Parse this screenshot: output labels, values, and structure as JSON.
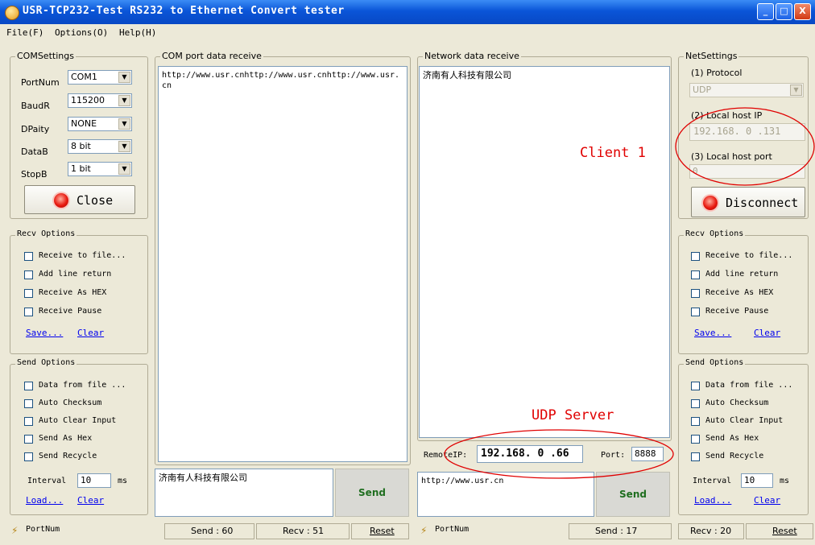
{
  "window": {
    "title": "USR-TCP232-Test  RS232 to Ethernet Convert tester",
    "minimize": "_",
    "maximize": "□",
    "close": "X"
  },
  "menu": {
    "file": "File(F)",
    "options": "Options(O)",
    "help": "Help(H)"
  },
  "com_settings": {
    "title": "COMSettings",
    "port_label": "PortNum",
    "port_value": "COM1",
    "baud_label": "BaudR",
    "baud_value": "115200",
    "parity_label": "DPaity",
    "parity_value": "NONE",
    "databits_label": "DataB",
    "databits_value": "8 bit",
    "stopbits_label": "StopB",
    "stopbits_value": "1 bit",
    "close_button": "Close"
  },
  "left_recv_options": {
    "title": "Recv Options",
    "items": [
      "Receive to file...",
      "Add line return",
      "Receive As HEX",
      "Receive Pause"
    ],
    "save": "Save...",
    "clear": "Clear"
  },
  "left_send_options": {
    "title": "Send Options",
    "items": [
      "Data from file ...",
      "Auto Checksum",
      "Auto Clear Input",
      "Send As Hex",
      "Send Recycle"
    ],
    "interval_label": "Interval",
    "interval_value": "10",
    "interval_unit": "ms",
    "load": "Load...",
    "clear": "Clear"
  },
  "com_receive": {
    "title": "COM port data receive",
    "text": "http://www.usr.cnhttp://www.usr.cnhttp://www.usr.cn"
  },
  "com_send": {
    "text": "济南有人科技有限公司",
    "send_button": "Send"
  },
  "net_receive": {
    "title": "Network data receive",
    "text": "济南有人科技有限公司"
  },
  "remote": {
    "ip_label": "RemoteIP:",
    "ip_value": "192.168. 0 .66",
    "port_label": "Port:",
    "port_value": "8888"
  },
  "net_send": {
    "text": "http://www.usr.cn",
    "send_button": "Send"
  },
  "net_settings": {
    "title": "NetSettings",
    "protocol_label": "(1) Protocol",
    "protocol_value": "UDP",
    "local_ip_label": "(2) Local host IP",
    "local_ip_value": "192.168. 0 .131",
    "local_port_label": "(3) Local host port",
    "local_port_value": "0",
    "disconnect_button": "Disconnect"
  },
  "right_recv_options": {
    "title": "Recv Options",
    "items": [
      "Receive to file...",
      "Add line return",
      "Receive As HEX",
      "Receive Pause"
    ],
    "save": "Save...",
    "clear": "Clear"
  },
  "right_send_options": {
    "title": "Send Options",
    "items": [
      "Data from file ...",
      "Auto Checksum",
      "Auto Clear Input",
      "Send As Hex",
      "Send Recycle"
    ],
    "interval_label": "Interval",
    "interval_value": "10",
    "interval_unit": "ms",
    "load": "Load...",
    "clear": "Clear"
  },
  "status_bar": {
    "left_portnum": "PortNum",
    "left_send": "Send : 60",
    "left_recv": "Recv : 51",
    "left_reset": "Reset",
    "right_portnum": "PortNum",
    "right_send": "Send : 17",
    "right_recv": "Recv : 20",
    "right_reset": "Reset"
  },
  "annotations": {
    "client": "Client 1",
    "server": "UDP Server"
  },
  "colors": {
    "titlebar": "#0a55d8",
    "annotation": "#e00000",
    "send_text": "#1f6e1f",
    "led": "#e81a10"
  }
}
